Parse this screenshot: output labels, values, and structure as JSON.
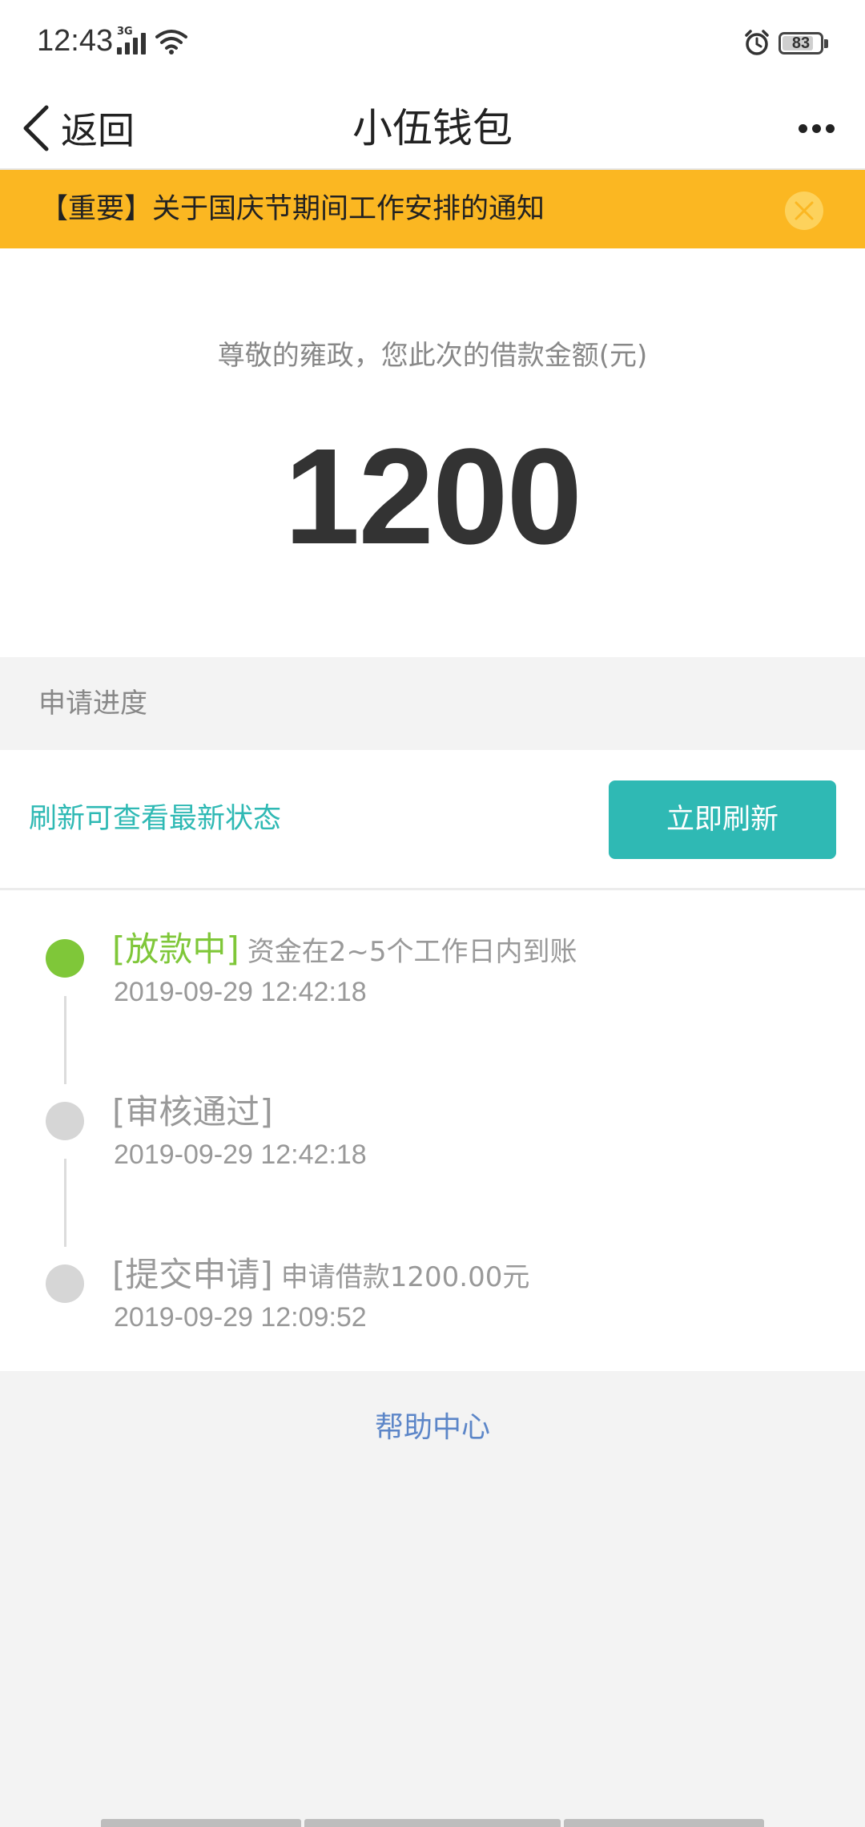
{
  "status_bar": {
    "time": "12:43",
    "network": "3G",
    "battery": "83",
    "battery_level_pct": 83,
    "icons": [
      "signal-icon",
      "wifi-icon",
      "alarm-icon",
      "battery-icon"
    ]
  },
  "nav": {
    "back_label": "返回",
    "title": "小伍钱包",
    "icons": [
      "back-chevron-icon",
      "more-icon"
    ]
  },
  "notice": {
    "text": "【重要】关于国庆节期间工作安排的通知",
    "close_icon": "close-icon"
  },
  "loan": {
    "greeting": "尊敬的雍政，您此次的借款金额(元)",
    "amount": "1200"
  },
  "progress": {
    "header": "申请进度",
    "refresh_hint": "刷新可查看最新状态",
    "refresh_button": "立即刷新"
  },
  "timeline": [
    {
      "title": "[放款中]",
      "desc": "资金在2~5个工作日内到账",
      "time": "2019-09-29 12:42:18",
      "active": true
    },
    {
      "title": "[审核通过]",
      "desc": "",
      "time": "2019-09-29 12:42:18",
      "active": false
    },
    {
      "title": "[提交申请]",
      "desc": "申请借款1200.00元",
      "time": "2019-09-29 12:09:52",
      "active": false
    }
  ],
  "footer": {
    "help_center": "帮助中心"
  },
  "colors": {
    "accent_teal": "#2fb9b4",
    "notice_yellow": "#fbb722",
    "active_green": "#7fc739",
    "link_blue": "#5c86c8"
  }
}
